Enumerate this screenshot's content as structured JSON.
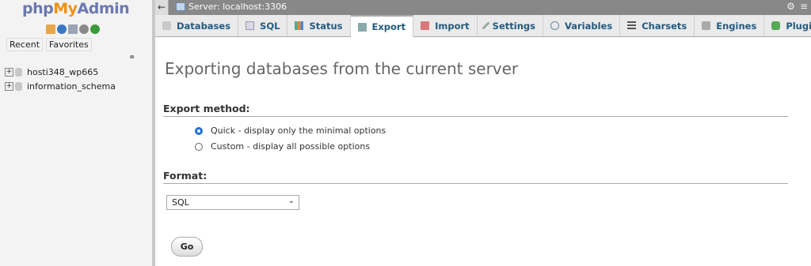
{
  "sidebar": {
    "logo": {
      "php": "php",
      "my": "My",
      "admin": "Admin"
    },
    "nav_icons": [
      "home-icon",
      "logout-icon",
      "docs-icon",
      "settings-icon",
      "reload-icon"
    ],
    "recent_label": "Recent",
    "favorites_label": "Favorites",
    "databases": [
      {
        "name": "hosti348_wp665",
        "expander": "+"
      },
      {
        "name": "information_schema",
        "expander": "+"
      }
    ]
  },
  "topbar": {
    "back_label": "←",
    "server": "Server: localhost:3306",
    "settings_glyph": "⚙",
    "collapse_glyph": "≡"
  },
  "tabs": [
    {
      "label": "Databases",
      "icon": "database-icon",
      "active": false
    },
    {
      "label": "SQL",
      "icon": "sql-icon",
      "active": false
    },
    {
      "label": "Status",
      "icon": "status-icon",
      "active": false
    },
    {
      "label": "Export",
      "icon": "export-icon",
      "active": true
    },
    {
      "label": "Import",
      "icon": "import-icon",
      "active": false
    },
    {
      "label": "Settings",
      "icon": "wrench-icon",
      "active": false
    },
    {
      "label": "Variables",
      "icon": "variables-icon",
      "active": false
    },
    {
      "label": "Charsets",
      "icon": "charsets-icon",
      "active": false
    },
    {
      "label": "Engines",
      "icon": "engines-icon",
      "active": false
    },
    {
      "label": "Plugins",
      "icon": "plugins-icon",
      "active": false
    }
  ],
  "main": {
    "title": "Exporting databases from the current server",
    "export_method_heading": "Export method:",
    "options": [
      {
        "label": "Quick - display only the minimal options",
        "checked": true
      },
      {
        "label": "Custom - display all possible options",
        "checked": false
      }
    ],
    "format_heading": "Format:",
    "format_value": "SQL",
    "go_label": "Go"
  },
  "colors": {
    "tab_text": "#235a81",
    "logo_blue": "#6c78af",
    "logo_orange": "#f29111",
    "radio_checked": "#1f6fd6"
  }
}
